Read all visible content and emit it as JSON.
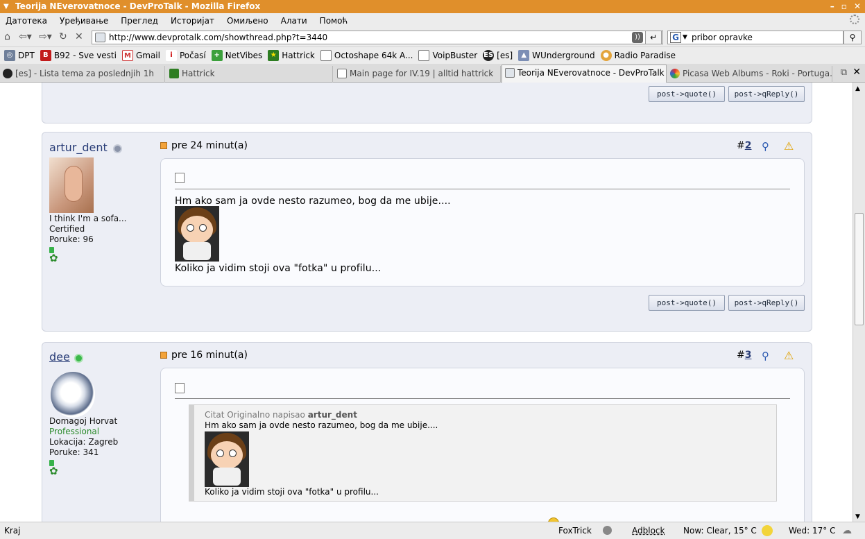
{
  "window": {
    "title": "Teorija NEverovatnoce - DevProTalk - Mozilla Firefox"
  },
  "menu": [
    "Датотека",
    "Уређивање",
    "Преглед",
    "Историјат",
    "Омиљено",
    "Алати",
    "Помоћ"
  ],
  "nav": {
    "url": "http://www.devprotalk.com/showthread.php?t=3440",
    "search_value": "pribor opravke"
  },
  "bookmarks": [
    "DPT",
    "B92 - Sve vesti",
    "Gmail",
    "Počasí",
    "NetVibes",
    "Hattrick",
    "Octoshape 64k A...",
    "VoipBuster",
    "[es]",
    "WUnderground",
    "Radio Paradise"
  ],
  "tabs": [
    "[es] - Lista tema za poslednjih 1h",
    "Hattrick",
    "Main page for IV.19 | alltid hattrick",
    "Teorija NEverovatnoce - DevProTalk",
    "Picasa Web Albums - Roki - Portuga..."
  ],
  "buttons": {
    "quote": "post->quote()",
    "qreply": "post->qReply()"
  },
  "posts": [
    {
      "user": "artur_dent",
      "date": "pre 24 minut(a)",
      "num_prefix": "#",
      "num": "2",
      "title": "I think I'm a sofa...",
      "rank": "Certified",
      "location": "",
      "posts": "Poruke: 96",
      "text1": "Hm ako sam ja ovde nesto razumeo, bog da me ubije....",
      "text2": "Koliko ja vidim stoji ova \"fotka\" u profilu..."
    },
    {
      "user": "dee",
      "date": "pre 16 minut(a)",
      "num_prefix": "#",
      "num": "3",
      "title": "Domagoj Horvat",
      "rank": "Professional",
      "location": "Lokacija: Zagreb",
      "posts": "Poruke: 341",
      "quote_prefix": "Citat Originalno napisao",
      "quote_author": "artur_dent",
      "quote_text1": "Hm ako sam ja ovde nesto razumeo, bog da me ubije....",
      "quote_text2": "Koliko ja vidim stoji ova \"fotka\" u profilu..."
    }
  ],
  "status": {
    "left": "Kraj",
    "foxtrick": "FoxTrick",
    "adblock": "Adblock",
    "weather1": "Now: Clear, 15° C",
    "weather2": "Wed: 17° C"
  },
  "colors": {
    "titlebar": "#e08f2b",
    "post_bg": "#eceef5",
    "online": "#3bb84a",
    "offline": "#8a93a8"
  }
}
